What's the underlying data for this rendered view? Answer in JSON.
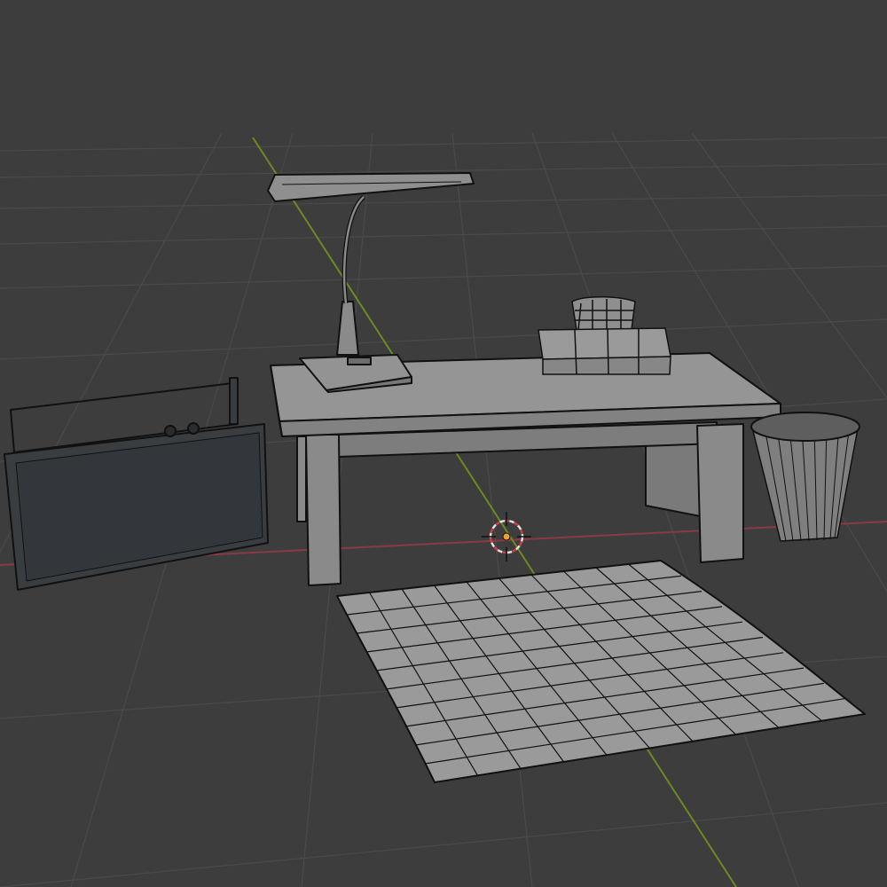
{
  "viewport": {
    "background_color": "#3d3d3d",
    "grid_color": "#4a4a4a",
    "x_axis_color": "#8a3a44",
    "y_axis_color": "#6b8a22",
    "mesh_fill": "#8c8c8c",
    "mesh_dark_fill": "#3a3d40",
    "wire_color": "#111111",
    "cursor_color": "#e0e0e0",
    "cursor_accent": "#c84040",
    "origin_color": "#f0a030"
  },
  "objects": [
    {
      "name": "desk-lamp"
    },
    {
      "name": "tissue-box"
    },
    {
      "name": "low-table"
    },
    {
      "name": "radio"
    },
    {
      "name": "waste-basket"
    },
    {
      "name": "floor-cushion"
    }
  ]
}
